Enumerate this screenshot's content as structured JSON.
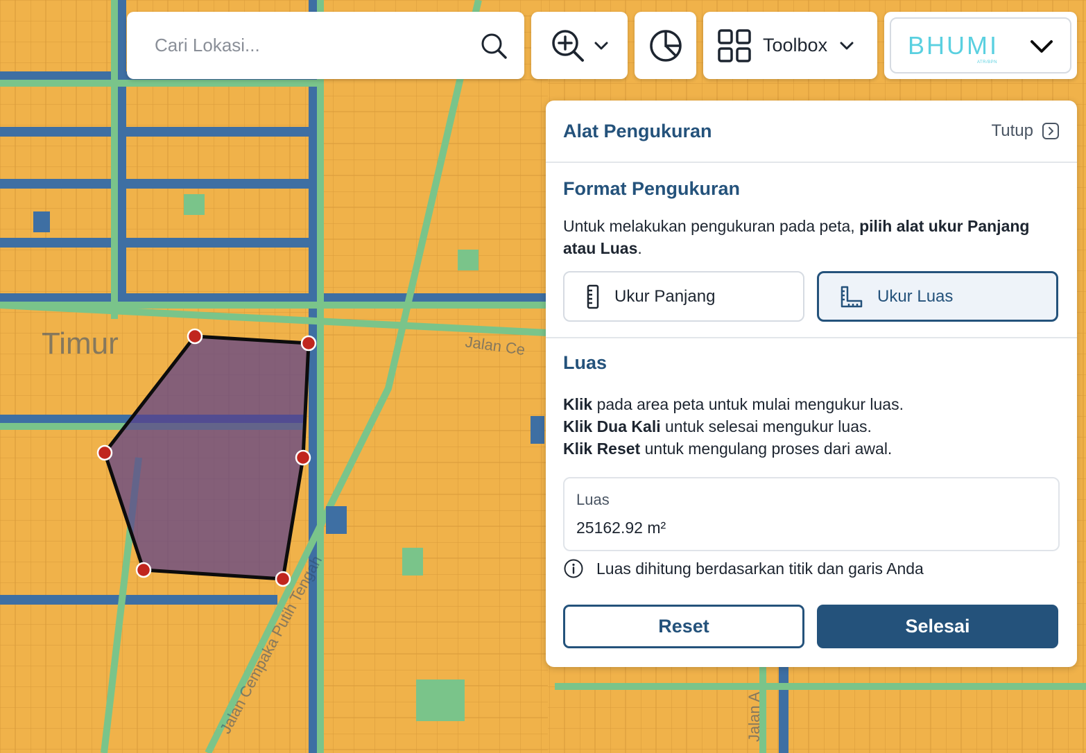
{
  "search": {
    "placeholder": "Cari Lokasi..."
  },
  "toolbar": {
    "toolbox_label": "Toolbox"
  },
  "brand": {
    "logo_text": "BHUMI",
    "logo_sub": "ATR/BPN"
  },
  "panel": {
    "title": "Alat Pengukuran",
    "close_label": "Tutup",
    "format_title": "Format Pengukuran",
    "format_desc_prefix": "Untuk melakukan pengukuran pada peta, ",
    "format_desc_bold": "pilih alat ukur Panjang atau Luas",
    "format_desc_suffix": ".",
    "tools": [
      {
        "label": "Ukur Panjang",
        "icon": "ruler-icon",
        "active": false
      },
      {
        "label": "Ukur Luas",
        "icon": "area-ruler-icon",
        "active": true
      }
    ],
    "area_title": "Luas",
    "instructions": [
      {
        "bold": "Klik",
        "text": " pada area peta untuk mulai mengukur luas."
      },
      {
        "bold": "Klik Dua Kali",
        "text": " untuk selesai mengukur luas."
      },
      {
        "bold": "Klik Reset",
        "text": " untuk mengulang proses dari awal."
      }
    ],
    "result_label": "Luas",
    "result_value": "25162.92 m²",
    "note": "Luas dihitung berdasarkan titik dan garis Anda",
    "reset_label": "Reset",
    "done_label": "Selesai"
  },
  "map": {
    "street_labels": [
      "Jalan Cempaka Putih Tengah",
      "Jalan Ce",
      "Timur",
      "Jalan A"
    ],
    "colors": {
      "parcel": "#f0b24a",
      "road": "#7ac48a",
      "water": "#3e6fa3",
      "polygon_fill": "#5a3f8a",
      "vertex": "#c0261e"
    }
  }
}
